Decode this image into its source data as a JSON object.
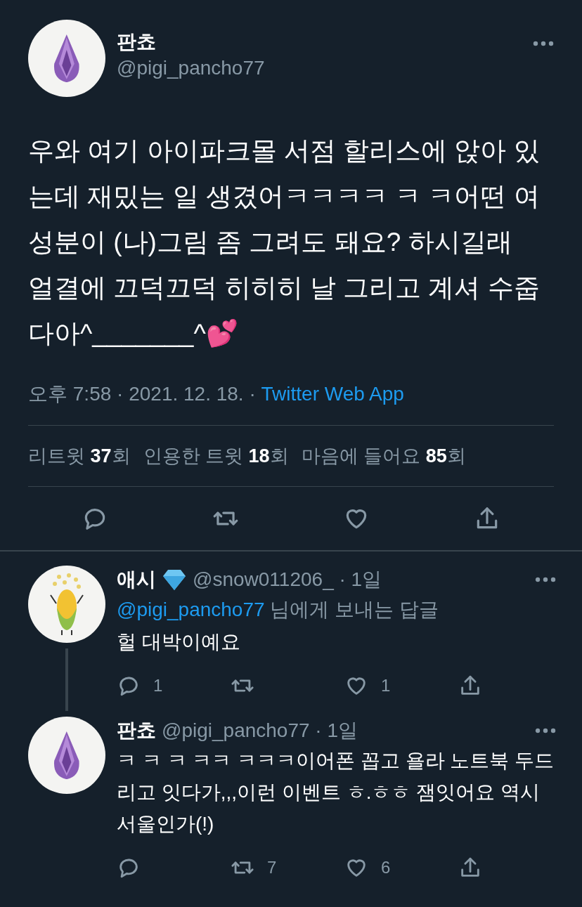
{
  "tweet": {
    "name": "판쵸",
    "handle": "@pigi_pancho77",
    "text": "우와 여기 아이파크몰 서점 할리스에 앉아 있는데 재밌는 일 생겼어ㅋㅋㅋㅋ ㅋ ㅋ어떤 여성분이 (나)그림 좀 그려도 돼요? 하시길래 얼결에 끄덕끄덕 히히히 날 그리고 계셔 수줍다아^_______^💕",
    "time": "오후 7:58 · 2021. 12. 18. · ",
    "source": "Twitter Web App",
    "stats": [
      {
        "label": "리트윗",
        "count": "37",
        "unit": "회"
      },
      {
        "label": "인용한 트윗",
        "count": "18",
        "unit": "회"
      },
      {
        "label": "마음에 들어요",
        "count": "85",
        "unit": "회"
      }
    ]
  },
  "replies": [
    {
      "name": "애시",
      "handle": "@snow011206_ · 1일",
      "kind": "corn",
      "reply_to": "@pigi_pancho77",
      "reply_to_suffix": "님에게 보내는 답글",
      "text": "헐 대박이예요",
      "replies": "1",
      "likes": "1",
      "thread": true
    },
    {
      "name": "판쵸",
      "handle": "@pigi_pancho77 · 1일",
      "kind": "gem",
      "text": "ㅋ ㅋ ㅋ ㅋㅋ ㅋㅋㅋ이어폰 꼽고 욜라 노트북 두드리고 잇다가,,,이런 이벤트 ㅎ.ㅎㅎ 잼잇어요 역시 서울인가(!)",
      "retweets": "7",
      "likes": "6",
      "thread": false
    }
  ]
}
